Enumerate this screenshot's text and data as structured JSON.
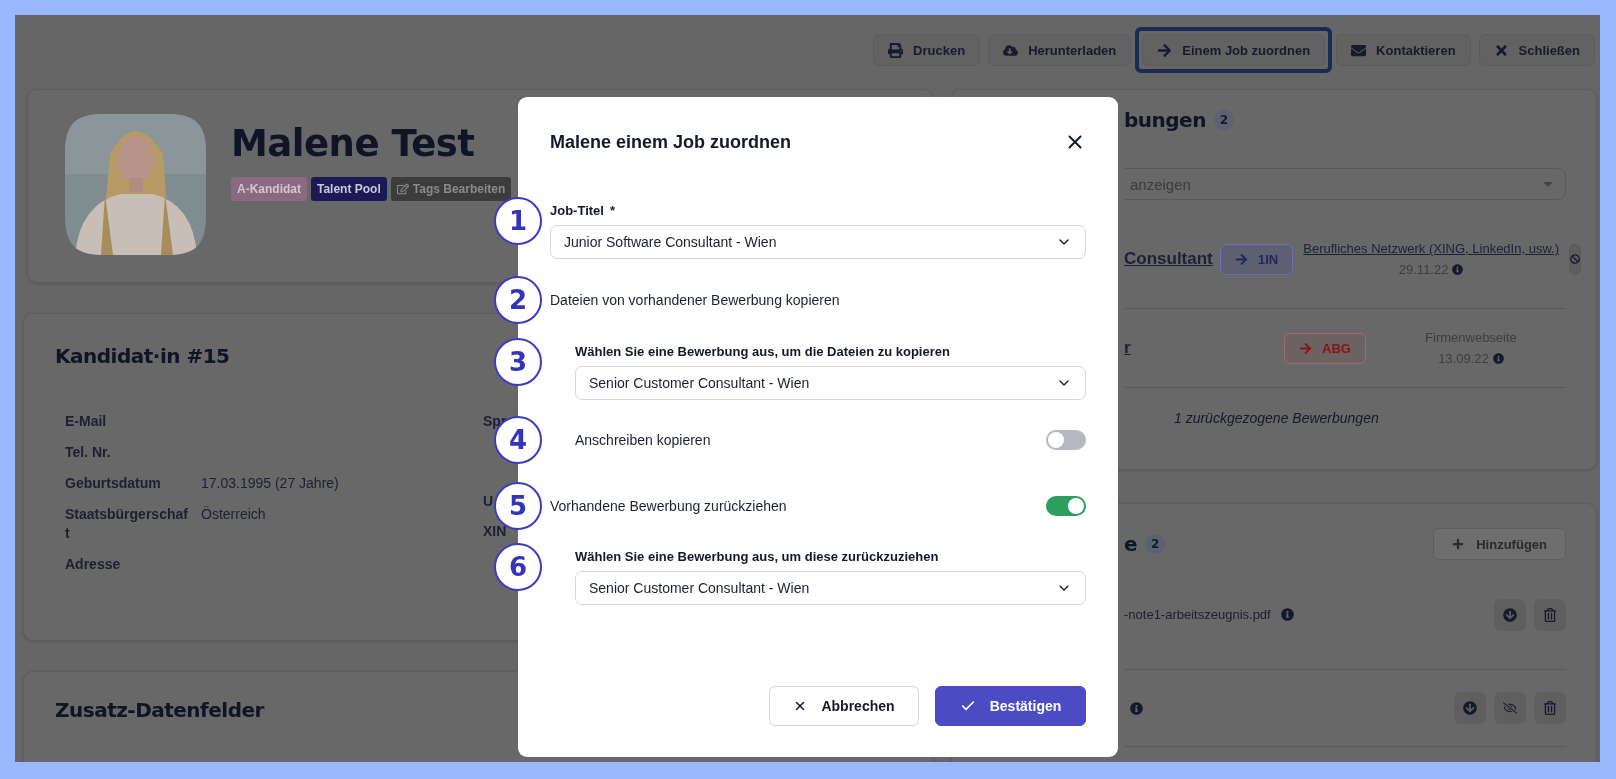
{
  "toolbar": [
    {
      "label": "Drucken",
      "highlighted": false
    },
    {
      "label": "Herunterladen",
      "highlighted": false
    },
    {
      "label": "Einem Job zuordnen",
      "highlighted": true
    },
    {
      "label": "Kontaktieren",
      "highlighted": false
    },
    {
      "label": "Schließen",
      "highlighted": false
    }
  ],
  "profile": {
    "name": "Malene Test",
    "tags": [
      {
        "label": "A-Kandidat",
        "color": "#8a6a80"
      },
      {
        "label": "Talent Pool",
        "color": "#1c1a55"
      }
    ],
    "edit_tags": "Tags Bearbeiten"
  },
  "candidate_card": {
    "title": "Kandidat·in #15",
    "fields": [
      {
        "label": "E-Mail"
      },
      {
        "label": "Tel. Nr."
      },
      {
        "label": "Geburtsdatum",
        "value": "17.03.1995 (27 Jahre)"
      },
      {
        "label": "Staatsbürgerschaft",
        "value": "Österreich"
      },
      {
        "label": "Adresse"
      }
    ],
    "column_2_labels": [
      "Spr",
      "U",
      "XIN"
    ]
  },
  "extra_fields_card": {
    "title": "Zusatz-Datenfelder"
  },
  "applications_card": {
    "title": "bungen",
    "count": "2",
    "filter": "anzeigen",
    "rows": [
      {
        "title": "Consultant",
        "status": "1IN",
        "kind": "active",
        "source": "Berufliches Netzwerk (XING, LinkedIn, usw.)",
        "source_link": true,
        "date": "29.11.22",
        "blockable": true
      },
      {
        "title": "r",
        "status": "ABG",
        "kind": "withdrawn",
        "source": "Firmenwebseite",
        "source_link": false,
        "date": "13.09.22",
        "blockable": false
      }
    ],
    "footer": "1 zurückgezogene Bewerbungen"
  },
  "documents_card": {
    "title": "e",
    "count": "2",
    "add_button": "Hinzufügen",
    "files": [
      {
        "name": "-note1-arbeitszeugnis.pdf",
        "hideable": false
      },
      {
        "hideable": true
      }
    ]
  },
  "modal": {
    "title": "Malene einem Job zuordnen",
    "fields": [
      {
        "kind": "select",
        "step": "1",
        "label": "Job-Titel",
        "required_mark": "*",
        "value": "Junior Software Consultant - Wien",
        "indented": false
      },
      {
        "kind": "text",
        "step": "2",
        "label": "Dateien von vorhandener Bewerbung kopieren",
        "indented": false
      },
      {
        "kind": "select",
        "step": "3",
        "label": "Wählen Sie eine Bewerbung aus, um die Dateien zu kopieren",
        "value": "Senior Customer Consultant - Wien",
        "indented": true
      },
      {
        "kind": "toggle",
        "step": "4",
        "label": "Anschreiben kopieren",
        "on": false,
        "indented": true
      },
      {
        "kind": "toggle",
        "step": "5",
        "label": "Vorhandene Bewerbung zurückziehen",
        "on": true,
        "indented": false
      },
      {
        "kind": "select",
        "step": "6",
        "label": "Wählen Sie eine Bewerbung aus, um diese zurückzuziehen",
        "value": "Senior Customer Consultant - Wien",
        "indented": true
      }
    ],
    "buttons": [
      {
        "label": "Abbrechen",
        "kind": "secondary"
      },
      {
        "label": "Bestätigen",
        "kind": "primary"
      }
    ]
  }
}
